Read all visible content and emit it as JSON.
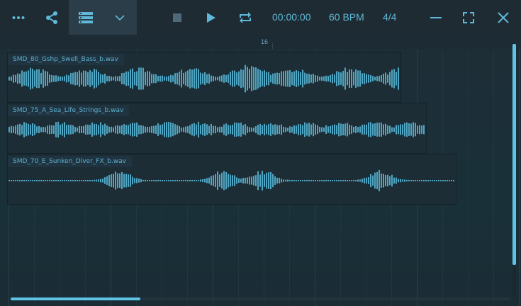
{
  "toolbar": {
    "icons": {
      "more": "more-dots-icon",
      "share": "share-icon",
      "tracks": "track-list-icon",
      "dropdown": "chevron-down-icon",
      "stop": "stop-icon",
      "play": "play-icon",
      "loop": "loop-icon",
      "minimize": "minimize-icon",
      "fullscreen": "fullscreen-icon",
      "close": "close-icon"
    },
    "time": "00:00:00",
    "tempo": "60 BPM",
    "signature": "4/4"
  },
  "ruler": {
    "label": "16"
  },
  "clips": [
    {
      "name": "SMD_80_Gshp_Swell_Bass_b.wav"
    },
    {
      "name": "SMD_75_A_Sea_Life_Strings_b.wav"
    },
    {
      "name": "SMD_70_E_Sunken_Diver_FX_b.wav"
    }
  ],
  "colors": {
    "accent": "#5ec4e6",
    "background": "#1c2a33",
    "toolbar": "#1f2b33"
  }
}
